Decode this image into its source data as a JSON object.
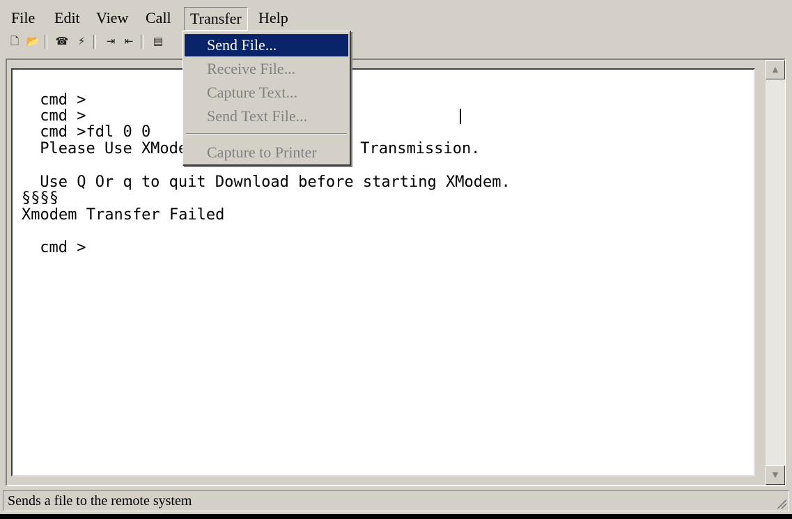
{
  "menubar": {
    "items": [
      {
        "label": "File"
      },
      {
        "label": "Edit"
      },
      {
        "label": "View"
      },
      {
        "label": "Call"
      },
      {
        "label": "Transfer"
      },
      {
        "label": "Help"
      }
    ]
  },
  "toolbar": {
    "buttons": [
      {
        "icon": "new-document-icon",
        "glyph": "🗋"
      },
      {
        "icon": "open-folder-icon",
        "glyph": "📂"
      },
      {
        "icon": "phone-icon",
        "glyph": "☎"
      },
      {
        "icon": "disconnect-icon",
        "glyph": "⚡"
      },
      {
        "icon": "send-icon",
        "glyph": "⇥"
      },
      {
        "icon": "receive-icon",
        "glyph": "⇤"
      },
      {
        "icon": "properties-icon",
        "glyph": "▤"
      }
    ]
  },
  "transfer_menu": {
    "items": [
      {
        "label": "Send File...",
        "selected": true
      },
      {
        "label": "Receive File..."
      },
      {
        "label": "Capture Text..."
      },
      {
        "label": "Send Text File..."
      },
      {
        "label": "Capture to Printer"
      }
    ]
  },
  "terminal": {
    "lines": [
      " cmd >",
      " cmd >",
      " cmd >fdl 0 0",
      " Please Use XModem",
      " Transmission.",
      " Use Q Or q to quit Download before starting XModem.",
      "§§§§",
      "Xmodem Transfer Failed",
      " cmd >"
    ]
  },
  "statusbar": {
    "text": "Sends a file to the remote system"
  },
  "colors": {
    "window_bg": "#d4d0c8",
    "selection": "#0a246a"
  }
}
